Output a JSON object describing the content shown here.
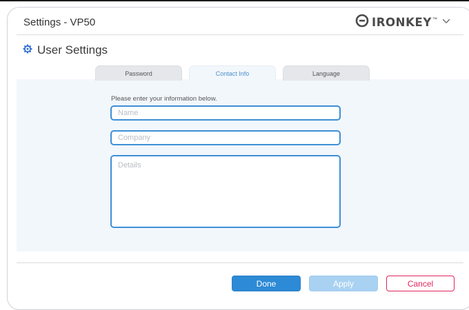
{
  "window": {
    "title": "Settings - VP50",
    "brand": "IRONKEY",
    "brand_mark": "™",
    "menu_icon": "chevron-down-icon"
  },
  "section": {
    "title": "User Settings",
    "icon": "gear-icon"
  },
  "tabs": [
    {
      "label": "Password",
      "active": false
    },
    {
      "label": "Contact Info",
      "active": true
    },
    {
      "label": "Language",
      "active": false
    }
  ],
  "form": {
    "instruction": "Please enter your information below.",
    "name": {
      "value": "",
      "placeholder": "Name"
    },
    "company": {
      "value": "",
      "placeholder": "Company"
    },
    "details": {
      "value": "",
      "placeholder": "Details"
    }
  },
  "buttons": {
    "done": "Done",
    "apply": "Apply",
    "cancel": "Cancel"
  },
  "colors": {
    "accent": "#2d8ad6",
    "field_border": "#3d8fd6",
    "apply_disabled": "#a9d1f2",
    "cancel": "#e2245c",
    "panel_bg": "#f2f7fc"
  }
}
